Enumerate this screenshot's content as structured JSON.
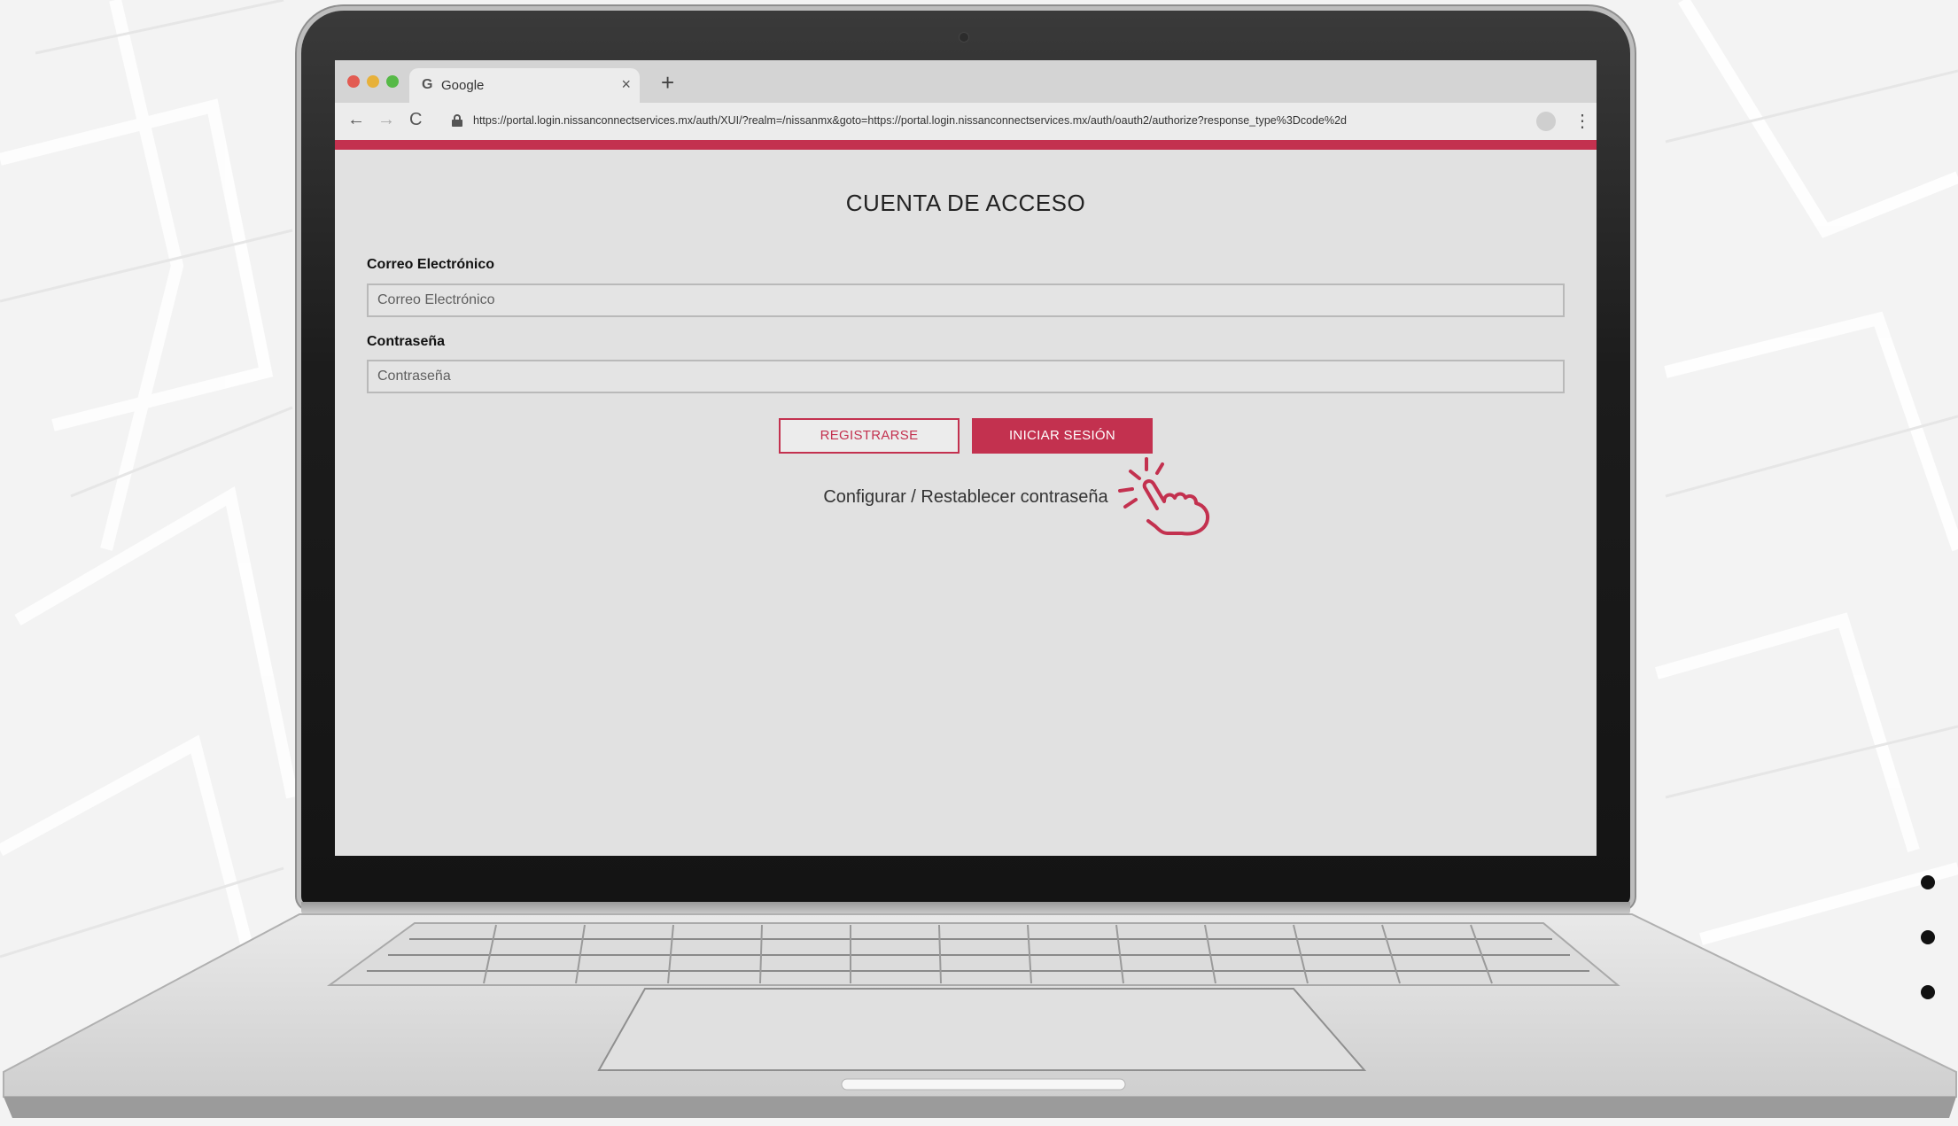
{
  "browser": {
    "tab_icon": "G",
    "tab_title": "Google",
    "tab_close": "×",
    "new_tab": "+",
    "back_icon": "←",
    "forward_icon": "→",
    "reload_icon": "C",
    "url": "https://portal.login.nissanconnectservices.mx/auth/XUI/?realm=/nissanmx&goto=https://portal.login.nissanconnectservices.mx/auth/oauth2/authorize?response_type%3Dcode%2d",
    "menu_icon": "⋮"
  },
  "login": {
    "title": "CUENTA DE ACCESO",
    "email_label": "Correo Electrónico",
    "email_placeholder": "Correo Electrónico",
    "password_label": "Contraseña",
    "password_placeholder": "Contraseña",
    "register_button": "REGISTRARSE",
    "login_button": "INICIAR SESIÓN",
    "reset_link": "Configurar / Restablecer contraseña"
  },
  "colors": {
    "accent": "#c3314f",
    "page_background": "#e1e1e1"
  }
}
